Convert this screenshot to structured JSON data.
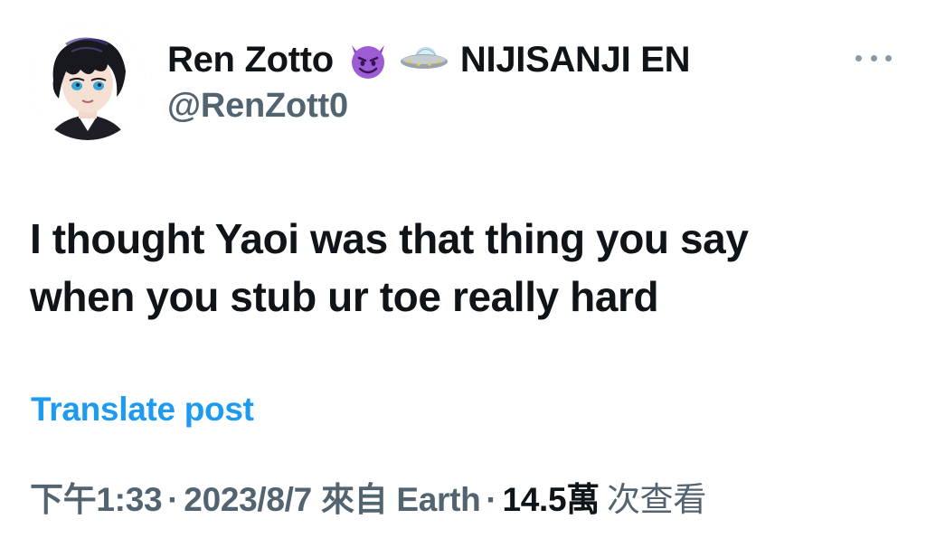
{
  "author": {
    "display_name": "Ren Zotto",
    "emoji_1": "smiling-devil-emoji",
    "emoji_2": "ufo-emoji",
    "affiliation": "NIJISANJI EN",
    "handle": "@RenZott0"
  },
  "more_icon": "more-horizontal-icon",
  "post": {
    "text_line_1": "I thought Yaoi was that thing you say",
    "text_line_2": "when you stub ur toe really hard"
  },
  "translate_label": "Translate post",
  "meta": {
    "time": "下午1:33",
    "date": "2023/8/7",
    "source": "來自 Earth",
    "separator": "·",
    "views_count": "14.5萬",
    "views_label": "次查看"
  },
  "colors": {
    "text_primary": "#0f1419",
    "text_secondary": "#536471",
    "link": "#1d9bf0",
    "emoji_purple": "#9b5cd6"
  }
}
